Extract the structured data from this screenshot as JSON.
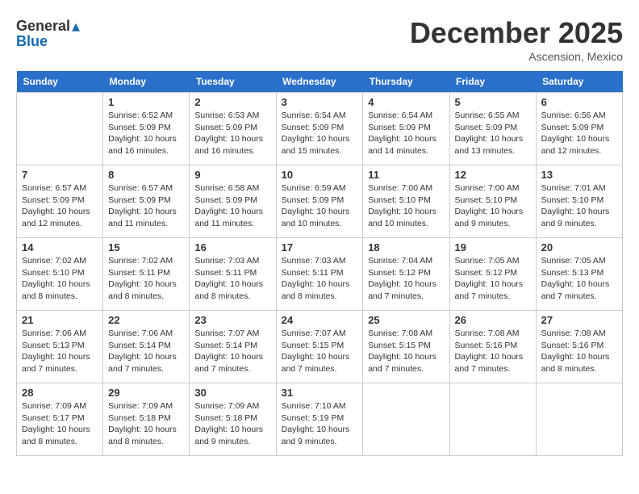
{
  "logo": {
    "general": "General",
    "blue": "Blue"
  },
  "title": "December 2025",
  "location": "Ascension, Mexico",
  "days_of_week": [
    "Sunday",
    "Monday",
    "Tuesday",
    "Wednesday",
    "Thursday",
    "Friday",
    "Saturday"
  ],
  "weeks": [
    [
      {
        "day": "",
        "sunrise": "",
        "sunset": "",
        "daylight": ""
      },
      {
        "day": "1",
        "sunrise": "Sunrise: 6:52 AM",
        "sunset": "Sunset: 5:09 PM",
        "daylight": "Daylight: 10 hours and 16 minutes."
      },
      {
        "day": "2",
        "sunrise": "Sunrise: 6:53 AM",
        "sunset": "Sunset: 5:09 PM",
        "daylight": "Daylight: 10 hours and 16 minutes."
      },
      {
        "day": "3",
        "sunrise": "Sunrise: 6:54 AM",
        "sunset": "Sunset: 5:09 PM",
        "daylight": "Daylight: 10 hours and 15 minutes."
      },
      {
        "day": "4",
        "sunrise": "Sunrise: 6:54 AM",
        "sunset": "Sunset: 5:09 PM",
        "daylight": "Daylight: 10 hours and 14 minutes."
      },
      {
        "day": "5",
        "sunrise": "Sunrise: 6:55 AM",
        "sunset": "Sunset: 5:09 PM",
        "daylight": "Daylight: 10 hours and 13 minutes."
      },
      {
        "day": "6",
        "sunrise": "Sunrise: 6:56 AM",
        "sunset": "Sunset: 5:09 PM",
        "daylight": "Daylight: 10 hours and 12 minutes."
      }
    ],
    [
      {
        "day": "7",
        "sunrise": "Sunrise: 6:57 AM",
        "sunset": "Sunset: 5:09 PM",
        "daylight": "Daylight: 10 hours and 12 minutes."
      },
      {
        "day": "8",
        "sunrise": "Sunrise: 6:57 AM",
        "sunset": "Sunset: 5:09 PM",
        "daylight": "Daylight: 10 hours and 11 minutes."
      },
      {
        "day": "9",
        "sunrise": "Sunrise: 6:58 AM",
        "sunset": "Sunset: 5:09 PM",
        "daylight": "Daylight: 10 hours and 11 minutes."
      },
      {
        "day": "10",
        "sunrise": "Sunrise: 6:59 AM",
        "sunset": "Sunset: 5:09 PM",
        "daylight": "Daylight: 10 hours and 10 minutes."
      },
      {
        "day": "11",
        "sunrise": "Sunrise: 7:00 AM",
        "sunset": "Sunset: 5:10 PM",
        "daylight": "Daylight: 10 hours and 10 minutes."
      },
      {
        "day": "12",
        "sunrise": "Sunrise: 7:00 AM",
        "sunset": "Sunset: 5:10 PM",
        "daylight": "Daylight: 10 hours and 9 minutes."
      },
      {
        "day": "13",
        "sunrise": "Sunrise: 7:01 AM",
        "sunset": "Sunset: 5:10 PM",
        "daylight": "Daylight: 10 hours and 9 minutes."
      }
    ],
    [
      {
        "day": "14",
        "sunrise": "Sunrise: 7:02 AM",
        "sunset": "Sunset: 5:10 PM",
        "daylight": "Daylight: 10 hours and 8 minutes."
      },
      {
        "day": "15",
        "sunrise": "Sunrise: 7:02 AM",
        "sunset": "Sunset: 5:11 PM",
        "daylight": "Daylight: 10 hours and 8 minutes."
      },
      {
        "day": "16",
        "sunrise": "Sunrise: 7:03 AM",
        "sunset": "Sunset: 5:11 PM",
        "daylight": "Daylight: 10 hours and 8 minutes."
      },
      {
        "day": "17",
        "sunrise": "Sunrise: 7:03 AM",
        "sunset": "Sunset: 5:11 PM",
        "daylight": "Daylight: 10 hours and 8 minutes."
      },
      {
        "day": "18",
        "sunrise": "Sunrise: 7:04 AM",
        "sunset": "Sunset: 5:12 PM",
        "daylight": "Daylight: 10 hours and 7 minutes."
      },
      {
        "day": "19",
        "sunrise": "Sunrise: 7:05 AM",
        "sunset": "Sunset: 5:12 PM",
        "daylight": "Daylight: 10 hours and 7 minutes."
      },
      {
        "day": "20",
        "sunrise": "Sunrise: 7:05 AM",
        "sunset": "Sunset: 5:13 PM",
        "daylight": "Daylight: 10 hours and 7 minutes."
      }
    ],
    [
      {
        "day": "21",
        "sunrise": "Sunrise: 7:06 AM",
        "sunset": "Sunset: 5:13 PM",
        "daylight": "Daylight: 10 hours and 7 minutes."
      },
      {
        "day": "22",
        "sunrise": "Sunrise: 7:06 AM",
        "sunset": "Sunset: 5:14 PM",
        "daylight": "Daylight: 10 hours and 7 minutes."
      },
      {
        "day": "23",
        "sunrise": "Sunrise: 7:07 AM",
        "sunset": "Sunset: 5:14 PM",
        "daylight": "Daylight: 10 hours and 7 minutes."
      },
      {
        "day": "24",
        "sunrise": "Sunrise: 7:07 AM",
        "sunset": "Sunset: 5:15 PM",
        "daylight": "Daylight: 10 hours and 7 minutes."
      },
      {
        "day": "25",
        "sunrise": "Sunrise: 7:08 AM",
        "sunset": "Sunset: 5:15 PM",
        "daylight": "Daylight: 10 hours and 7 minutes."
      },
      {
        "day": "26",
        "sunrise": "Sunrise: 7:08 AM",
        "sunset": "Sunset: 5:16 PM",
        "daylight": "Daylight: 10 hours and 7 minutes."
      },
      {
        "day": "27",
        "sunrise": "Sunrise: 7:08 AM",
        "sunset": "Sunset: 5:16 PM",
        "daylight": "Daylight: 10 hours and 8 minutes."
      }
    ],
    [
      {
        "day": "28",
        "sunrise": "Sunrise: 7:09 AM",
        "sunset": "Sunset: 5:17 PM",
        "daylight": "Daylight: 10 hours and 8 minutes."
      },
      {
        "day": "29",
        "sunrise": "Sunrise: 7:09 AM",
        "sunset": "Sunset: 5:18 PM",
        "daylight": "Daylight: 10 hours and 8 minutes."
      },
      {
        "day": "30",
        "sunrise": "Sunrise: 7:09 AM",
        "sunset": "Sunset: 5:18 PM",
        "daylight": "Daylight: 10 hours and 9 minutes."
      },
      {
        "day": "31",
        "sunrise": "Sunrise: 7:10 AM",
        "sunset": "Sunset: 5:19 PM",
        "daylight": "Daylight: 10 hours and 9 minutes."
      },
      {
        "day": "",
        "sunrise": "",
        "sunset": "",
        "daylight": ""
      },
      {
        "day": "",
        "sunrise": "",
        "sunset": "",
        "daylight": ""
      },
      {
        "day": "",
        "sunrise": "",
        "sunset": "",
        "daylight": ""
      }
    ]
  ]
}
